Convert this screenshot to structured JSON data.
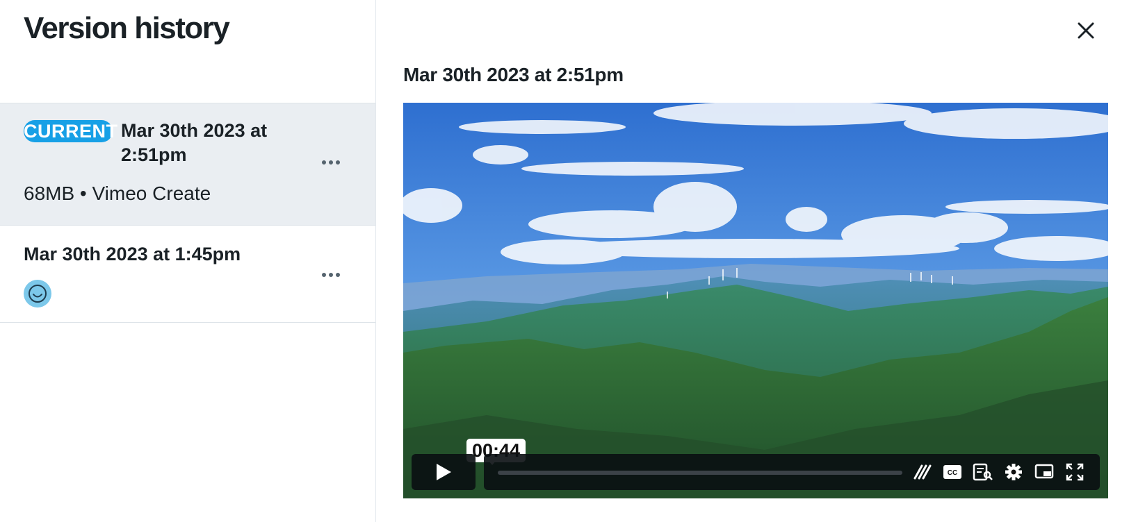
{
  "sidebar": {
    "title": "Version history",
    "versions": [
      {
        "badge": "CURRENT",
        "date": "Mar 30th 2023 at 2:51pm",
        "meta": "68MB • Vimeo Create"
      },
      {
        "date": "Mar 30th 2023 at 1:45pm"
      }
    ]
  },
  "preview": {
    "date": "Mar 30th 2023 at 2:51pm",
    "player": {
      "time": "00:44",
      "progress": 0
    }
  },
  "icons": {
    "close": "close-icon",
    "more": "more-options-icon",
    "avatar": "smiley-avatar-icon",
    "play": "play-icon",
    "speed": "speed-icon",
    "captions": "closed-captions-icon",
    "transcript": "transcript-search-icon",
    "settings": "gear-icon",
    "pip": "picture-in-picture-icon",
    "fullscreen": "fullscreen-icon"
  },
  "colors": {
    "badge": "#17a0e6",
    "selected_row": "#eaeef2",
    "avatar": "#7cc8ea"
  }
}
